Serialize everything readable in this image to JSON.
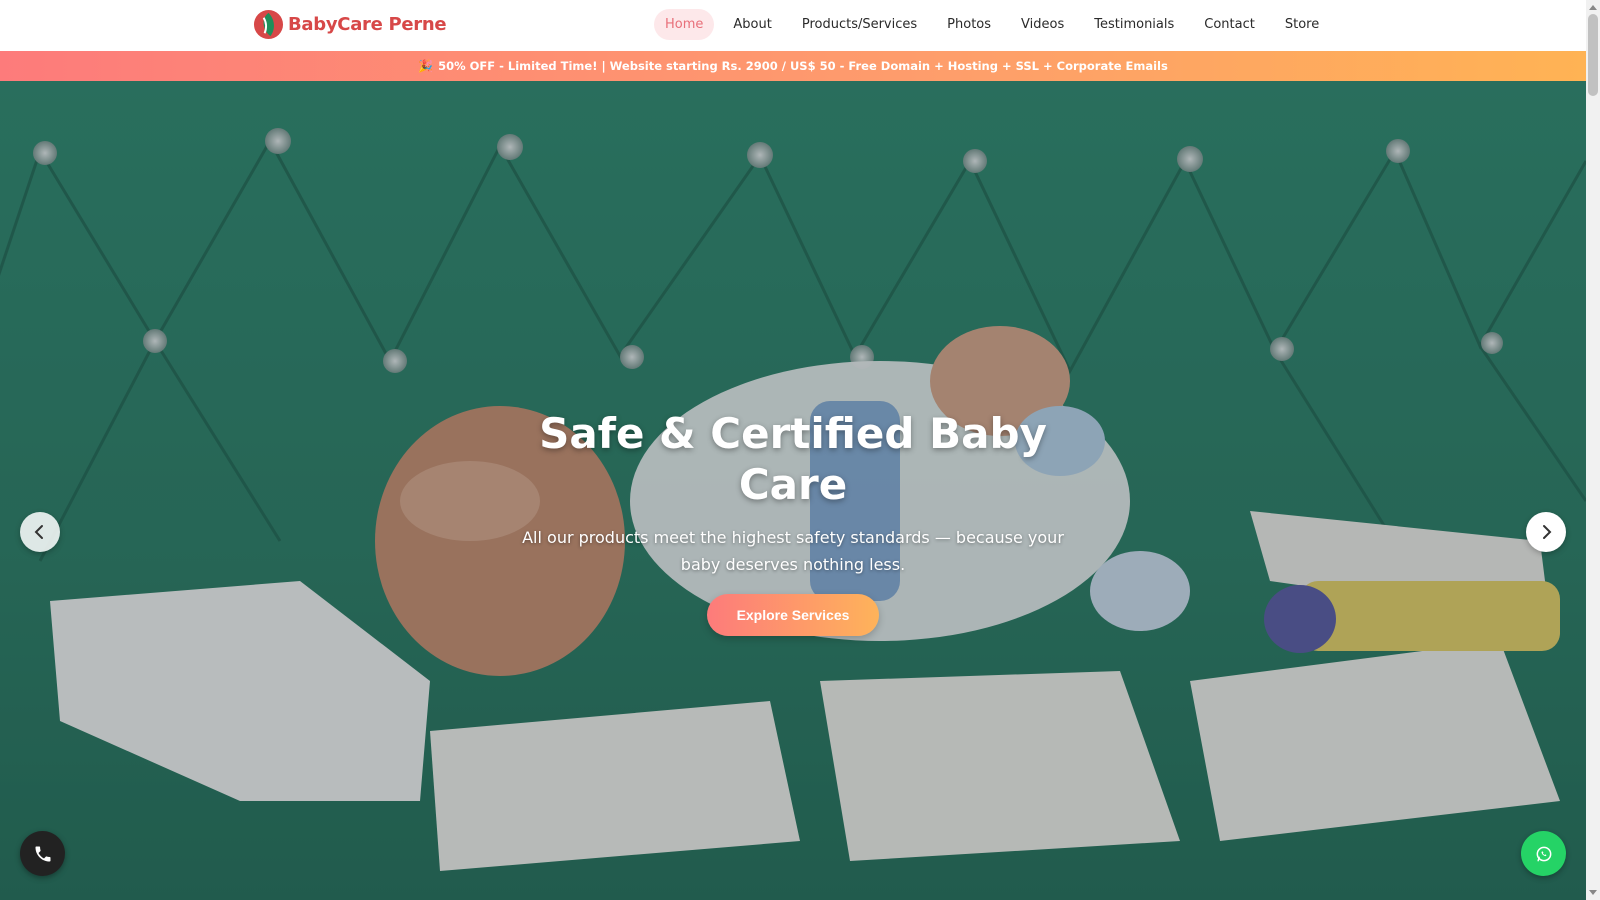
{
  "brand": {
    "name": "BabyCare Perne",
    "logo_icon": "leaf-drop-logo",
    "color": "#d74848"
  },
  "nav": {
    "items": [
      {
        "label": "Home",
        "active": true
      },
      {
        "label": "About",
        "active": false
      },
      {
        "label": "Products/Services",
        "active": false
      },
      {
        "label": "Photos",
        "active": false
      },
      {
        "label": "Videos",
        "active": false
      },
      {
        "label": "Testimonials",
        "active": false
      },
      {
        "label": "Contact",
        "active": false
      },
      {
        "label": "Store",
        "active": false
      }
    ]
  },
  "promo": {
    "icon": "party-popper-icon",
    "text": "50% OFF - Limited Time! | Website starting Rs. 2900 / US$ 50 - Free Domain + Hosting + SSL + Corporate Emails"
  },
  "hero": {
    "title": "Safe & Certified Baby Care",
    "subtitle": "All our products meet the highest safety standards — because your baby deserves nothing less.",
    "cta_label": "Explore Services",
    "prev_icon": "chevron-left-icon",
    "next_icon": "chevron-right-icon"
  },
  "floating": {
    "phone_icon": "phone-icon",
    "whatsapp_icon": "whatsapp-icon"
  },
  "colors": {
    "accent_start": "#fd7b7b",
    "accent_end": "#feb35a",
    "whatsapp": "#25d366",
    "nav_active_bg": "#fde8ea",
    "nav_active_text": "#e8707a"
  }
}
